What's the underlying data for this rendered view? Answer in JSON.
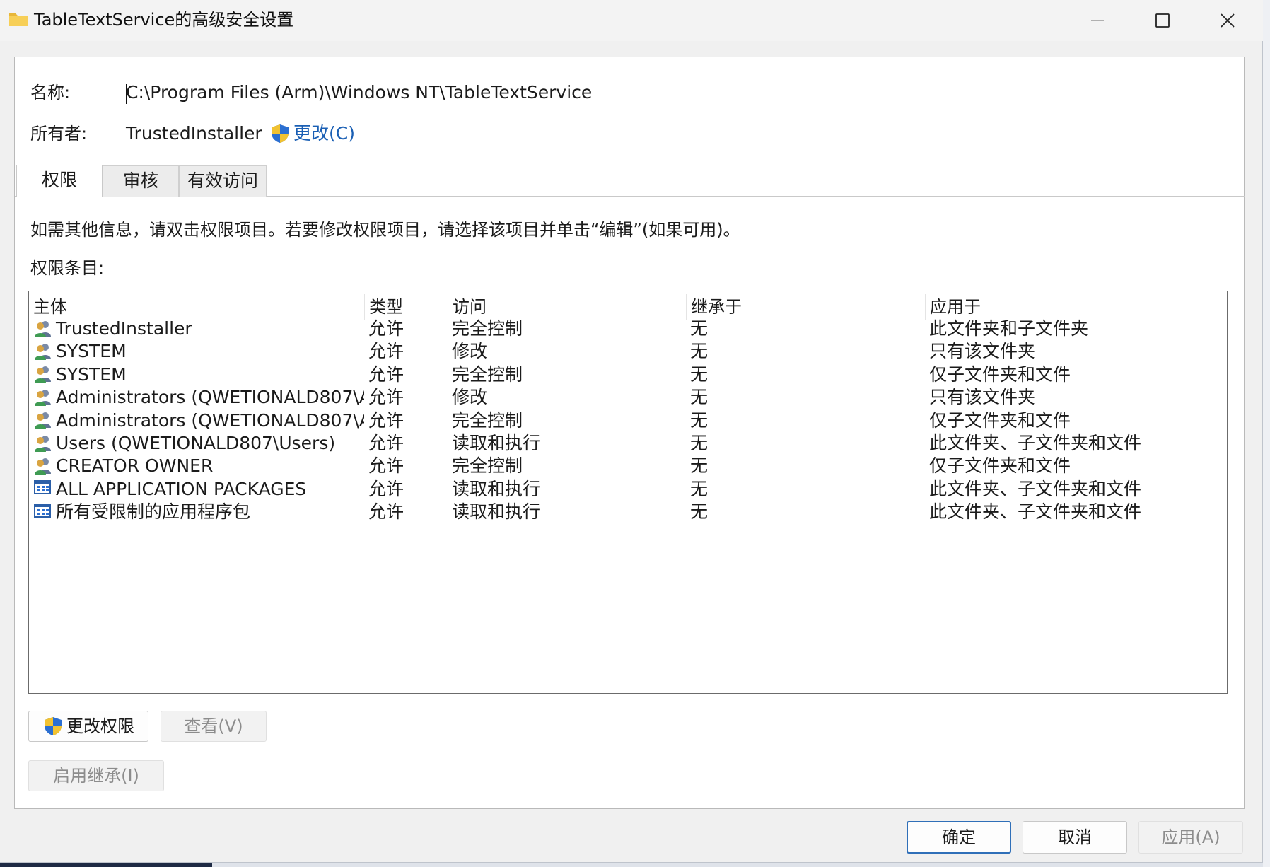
{
  "window": {
    "title": "TableTextService的高级安全设置",
    "minimize_glyph": "—",
    "maximize_glyph": "☐",
    "close_glyph": "✕"
  },
  "fields": {
    "name_label": "名称:",
    "name_value": "C:\\Program Files (Arm)\\Windows NT\\TableTextService",
    "owner_label": "所有者:",
    "owner_value": "TrustedInstaller",
    "change_owner_link": "更改(C)"
  },
  "tabs": [
    {
      "label": "权限",
      "active": true
    },
    {
      "label": "审核",
      "active": false
    },
    {
      "label": "有效访问",
      "active": false
    }
  ],
  "info_text": "如需其他信息，请双击权限项目。若要修改权限项目，请选择该项目并单击“编辑”(如果可用)。",
  "entries_label": "权限条目:",
  "table": {
    "columns": [
      "主体",
      "类型",
      "访问",
      "继承于",
      "应用于"
    ],
    "rows": [
      {
        "icon": "users-icon",
        "principal": "TrustedInstaller",
        "type": "允许",
        "access": "完全控制",
        "inherited": "无",
        "applies": "此文件夹和子文件夹"
      },
      {
        "icon": "users-icon",
        "principal": "SYSTEM",
        "type": "允许",
        "access": "修改",
        "inherited": "无",
        "applies": "只有该文件夹"
      },
      {
        "icon": "users-icon",
        "principal": "SYSTEM",
        "type": "允许",
        "access": "完全控制",
        "inherited": "无",
        "applies": "仅子文件夹和文件"
      },
      {
        "icon": "users-icon",
        "principal": "Administrators (QWETIONALD807\\A...",
        "type": "允许",
        "access": "修改",
        "inherited": "无",
        "applies": "只有该文件夹"
      },
      {
        "icon": "users-icon",
        "principal": "Administrators (QWETIONALD807\\A...",
        "type": "允许",
        "access": "完全控制",
        "inherited": "无",
        "applies": "仅子文件夹和文件"
      },
      {
        "icon": "users-icon",
        "principal": "Users (QWETIONALD807\\Users)",
        "type": "允许",
        "access": "读取和执行",
        "inherited": "无",
        "applies": "此文件夹、子文件夹和文件"
      },
      {
        "icon": "users-icon",
        "principal": "CREATOR OWNER",
        "type": "允许",
        "access": "完全控制",
        "inherited": "无",
        "applies": "仅子文件夹和文件"
      },
      {
        "icon": "app-packages-icon",
        "principal": "ALL APPLICATION PACKAGES",
        "type": "允许",
        "access": "读取和执行",
        "inherited": "无",
        "applies": "此文件夹、子文件夹和文件"
      },
      {
        "icon": "app-packages-icon",
        "principal": "所有受限制的应用程序包",
        "type": "允许",
        "access": "读取和执行",
        "inherited": "无",
        "applies": "此文件夹、子文件夹和文件"
      }
    ]
  },
  "buttons": {
    "change_permissions": "更改权限",
    "view": "查看(V)",
    "enable_inheritance": "启用继承(I)",
    "ok": "确定",
    "cancel": "取消",
    "apply": "应用(A)"
  },
  "colors": {
    "link": "#1a5fb4",
    "primary_border": "#2f6fb8",
    "disabled_text": "#8c8c8c"
  }
}
